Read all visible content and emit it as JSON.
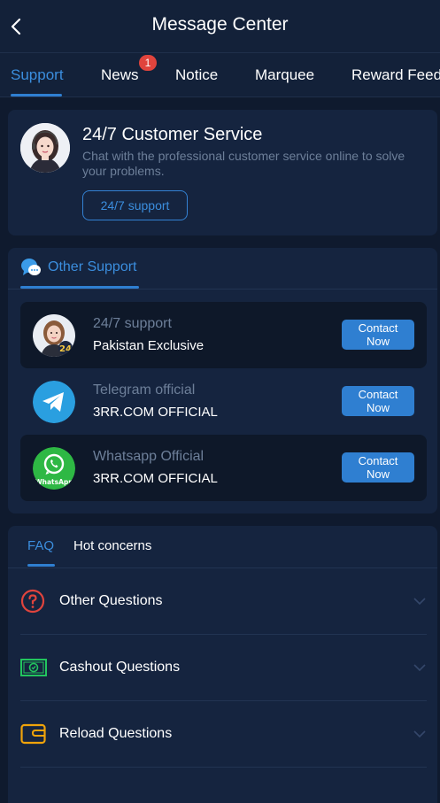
{
  "header": {
    "title": "Message Center",
    "back_icon": "chevron-left-icon"
  },
  "tabs": [
    {
      "label": "Support",
      "active": true
    },
    {
      "label": "News",
      "badge": "1"
    },
    {
      "label": "Notice"
    },
    {
      "label": "Marquee"
    },
    {
      "label": "Reward Feedback"
    }
  ],
  "customer_service": {
    "title": "24/7 Customer Service",
    "description": "Chat with the professional customer service online to solve your problems.",
    "button_label": "24/7 support",
    "avatar_icon": "agent-avatar-icon"
  },
  "other_support": {
    "title": "Other Support",
    "title_icon": "chat-bubbles-icon",
    "items": [
      {
        "label": "24/7 support",
        "sub": "Pakistan Exclusive",
        "button": "Contact Now",
        "icon": "agent-avatar-icon"
      },
      {
        "label": "Telegram official",
        "sub": "3RR.COM OFFICIAL",
        "button": "Contact Now",
        "icon": "telegram-icon"
      },
      {
        "label": "Whatsapp Official",
        "sub": "3RR.COM OFFICIAL",
        "button": "Contact Now",
        "icon": "whatsapp-icon",
        "icon_text": "WhatsApp"
      }
    ]
  },
  "faq": {
    "tabs": [
      {
        "label": "FAQ",
        "active": true
      },
      {
        "label": "Hot concerns"
      }
    ],
    "items": [
      {
        "label": "Other Questions",
        "icon": "question-circle-icon"
      },
      {
        "label": "Cashout Questions",
        "icon": "cash-icon"
      },
      {
        "label": "Reload Questions",
        "icon": "wallet-icon"
      }
    ]
  },
  "colors": {
    "accent": "#2f7fd1",
    "background": "#0f1a2e",
    "card": "#15243f",
    "badge": "#e0443d"
  }
}
